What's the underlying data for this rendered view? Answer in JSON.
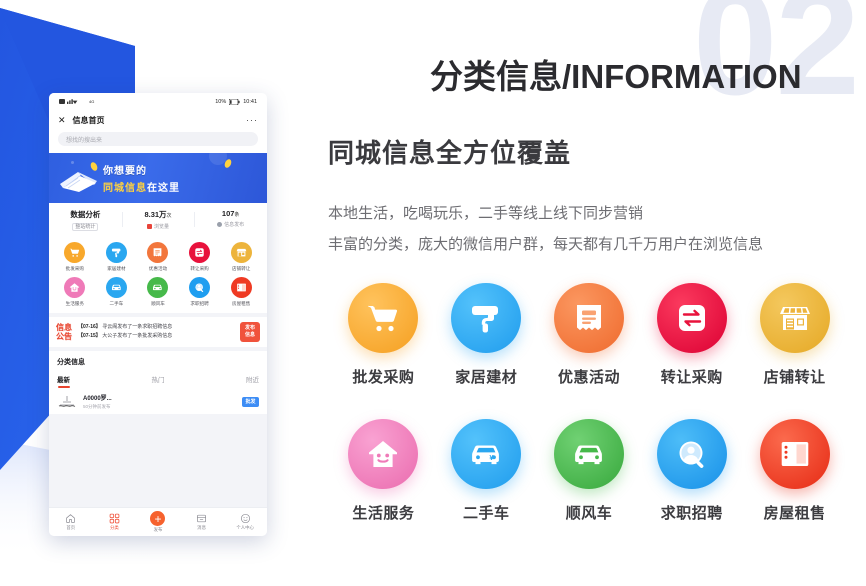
{
  "decor": {
    "number": "02",
    "accent": "#2a60e4"
  },
  "header": {
    "title": "分类信息/INFORMATION",
    "subtitle": "同城信息全方位覆盖",
    "desc_line1": "本地生活，吃喝玩乐，二手等线上线下同步营销",
    "desc_line2": "丰富的分类，庞大的微信用户群，每天都有几千万用户在浏览信息"
  },
  "categories": [
    {
      "label": "批发采购",
      "icon": "shopping-cart-icon",
      "color": "#f8a82c"
    },
    {
      "label": "家居建材",
      "icon": "paint-roller-icon",
      "color": "#2aa7f0"
    },
    {
      "label": "优惠活动",
      "icon": "receipt-icon",
      "color": "#f2763c"
    },
    {
      "label": "转让采购",
      "icon": "exchange-arrows-icon",
      "color": "#e8123c"
    },
    {
      "label": "店铺转让",
      "icon": "storefront-icon",
      "color": "#edb43c"
    },
    {
      "label": "生活服务",
      "icon": "smiling-house-icon",
      "color": "#ef7ab8"
    },
    {
      "label": "二手车",
      "icon": "car-yuan-icon",
      "color": "#2aa7f0"
    },
    {
      "label": "顺风车",
      "icon": "car-icon",
      "color": "#46b94a"
    },
    {
      "label": "求职招聘",
      "icon": "person-search-icon",
      "color": "#1f9ef0"
    },
    {
      "label": "房屋租售",
      "icon": "building-icon",
      "color": "#ef3a23"
    }
  ],
  "phone": {
    "status": {
      "battery": "10%",
      "time": "10:41",
      "signal": "4G"
    },
    "nav": {
      "close": "✕",
      "title": "信息首页",
      "more": "···"
    },
    "search": {
      "placeholder": "想找的搜出来"
    },
    "banner": {
      "line1": "你想要的",
      "line2_highlight": "同城信息",
      "line2_rest": "在这里"
    },
    "stats": {
      "title": "数据分析",
      "title_tag": "整站统计",
      "items": [
        {
          "value": "8.31万",
          "unit": "次",
          "label": "浏览量"
        },
        {
          "value": "107",
          "unit": "条",
          "label": "信息发布"
        }
      ]
    },
    "notice": {
      "badge_line1": "信息",
      "badge_line2": "公告",
      "rows": [
        {
          "date": "【07-16】",
          "text": "寻云阁发布了一条求职招聘信息"
        },
        {
          "date": "【07-15】",
          "text": "大公子发布了一条批发采购信息"
        }
      ],
      "publish_line1": "发布",
      "publish_line2": "信息"
    },
    "section": {
      "title": "分类信息",
      "tabs": [
        "最新",
        "热门",
        "附近"
      ]
    },
    "list_item": {
      "title": "A0000罗...",
      "sub": "50分钟前发布",
      "chip": "批发"
    },
    "tabbar": [
      {
        "label": "首页",
        "icon": "home-icon",
        "active": false
      },
      {
        "label": "分类",
        "icon": "grid-icon",
        "active": true
      },
      {
        "label": "发布",
        "icon": "plus-icon",
        "active": false
      },
      {
        "label": "消息",
        "icon": "message-icon",
        "active": false
      },
      {
        "label": "个人中心",
        "icon": "user-icon",
        "active": false
      }
    ]
  }
}
